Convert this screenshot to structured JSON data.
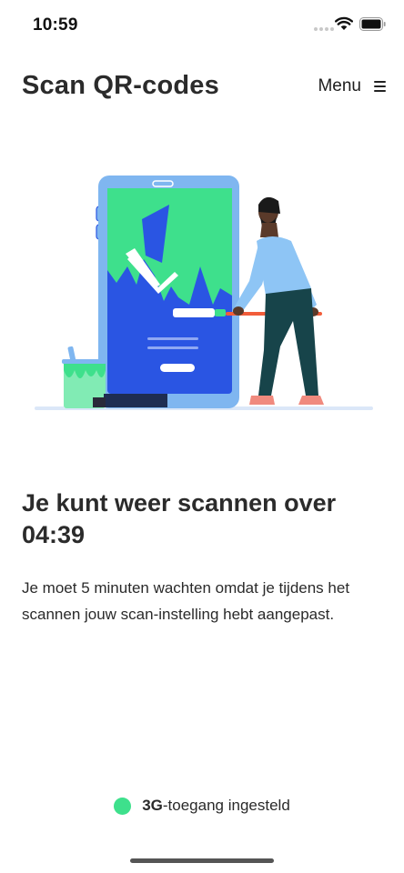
{
  "status_bar": {
    "time": "10:59"
  },
  "header": {
    "title": "Scan QR-codes",
    "menu_label": "Menu"
  },
  "content": {
    "title": "Je kunt weer scannen over 04:39",
    "body": "Je moet 5 minuten wachten omdat je tijdens het scannen jouw scan-instelling hebt aangepast."
  },
  "access_status": {
    "emphasis": "3G",
    "text": "-toegang ingesteld",
    "indicator_color": "#3ee08c"
  },
  "colors": {
    "brand_green": "#3ee08c",
    "phone_blue": "#2a55e3",
    "phone_frame": "#7fb6f0",
    "text_dark": "#2b2b2b"
  }
}
